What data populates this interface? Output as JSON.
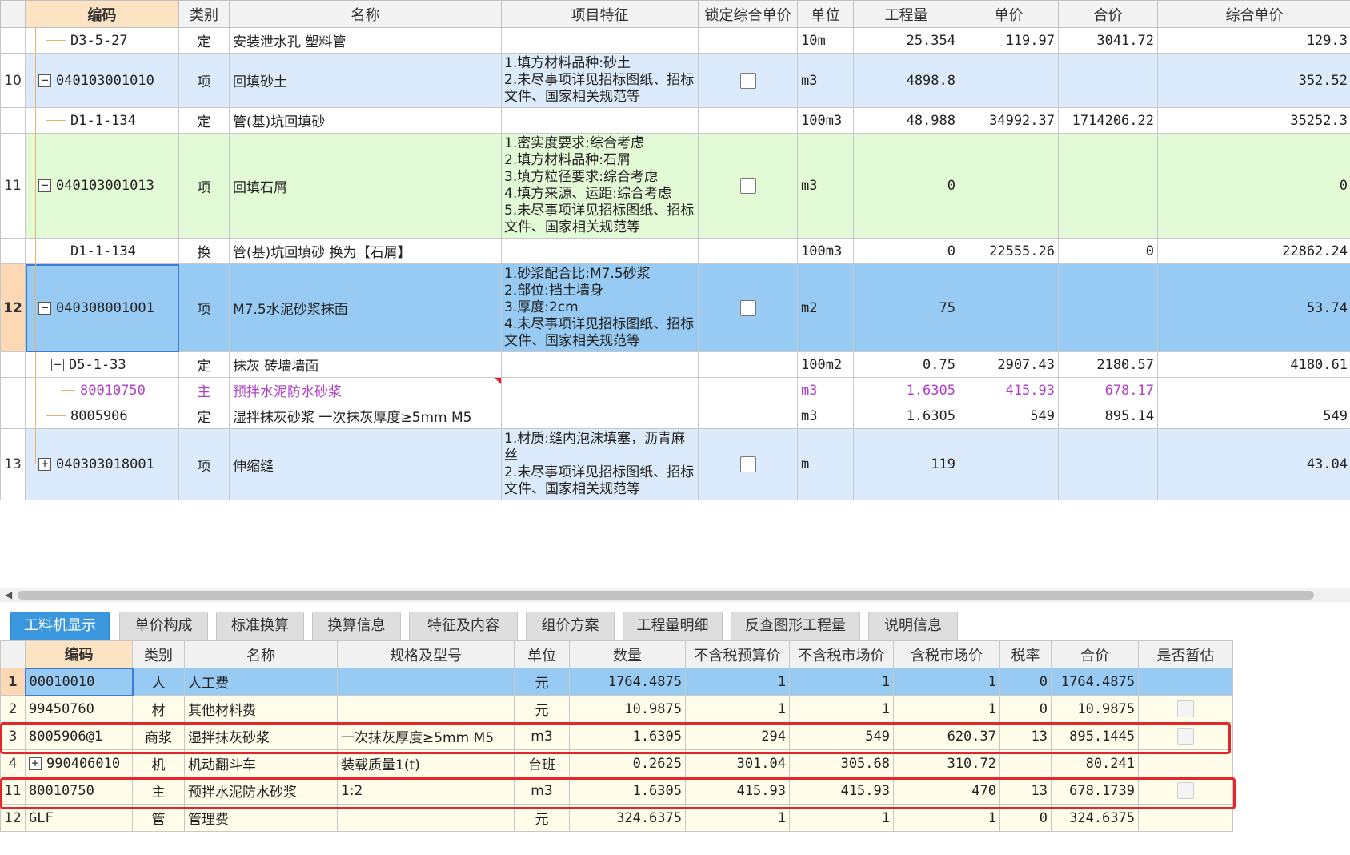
{
  "top_grid": {
    "headers": [
      "编码",
      "类别",
      "名称",
      "项目特征",
      "锁定综合单价",
      "单位",
      "工程量",
      "单价",
      "合价",
      "综合单价"
    ],
    "rows": [
      {
        "num": "",
        "code": "D3-5-27",
        "cat": "定",
        "name": "安装泄水孔 塑料管",
        "feat": [],
        "lock": false,
        "unit": "10m",
        "qty": "25.354",
        "price": "119.97",
        "total": "3041.72",
        "comp": "129.3"
      },
      {
        "num": "10",
        "code": "040103001010",
        "cat": "项",
        "name": "回填砂土",
        "feat": [
          "1.填方材料品种:砂土",
          "2.未尽事项详见招标图纸、招标",
          "文件、国家相关规范等"
        ],
        "lock": true,
        "unit": "m3",
        "qty": "4898.8",
        "price": "",
        "total": "",
        "comp": "352.52"
      },
      {
        "num": "",
        "code": "D1-1-134",
        "cat": "定",
        "name": "管(基)坑回填砂",
        "feat": [],
        "lock": false,
        "unit": "100m3",
        "qty": "48.988",
        "price": "34992.37",
        "total": "1714206.22",
        "comp": "35252.3"
      },
      {
        "num": "11",
        "code": "040103001013",
        "cat": "项",
        "name": "回填石屑",
        "feat": [
          "1.密实度要求:综合考虑",
          "2.填方材料品种:石屑",
          "3.填方粒径要求:综合考虑",
          "4.填方来源、运距:综合考虑",
          "5.未尽事项详见招标图纸、招标",
          "文件、国家相关规范等"
        ],
        "lock": true,
        "unit": "m3",
        "qty": "0",
        "price": "",
        "total": "",
        "comp": "0"
      },
      {
        "num": "",
        "code": "D1-1-134",
        "cat": "换",
        "name": "管(基)坑回填砂  换为【石屑】",
        "feat": [],
        "lock": false,
        "unit": "100m3",
        "qty": "0",
        "price": "22555.26",
        "total": "0",
        "comp": "22862.24"
      },
      {
        "num": "12",
        "code": "040308001001",
        "cat": "项",
        "name": "M7.5水泥砂浆抹面",
        "feat": [
          "1.砂浆配合比:M7.5砂浆",
          "2.部位:挡土墙身",
          "3.厚度:2cm",
          "4.未尽事项详见招标图纸、招标",
          "文件、国家相关规范等"
        ],
        "lock": true,
        "unit": "m2",
        "qty": "75",
        "price": "",
        "total": "",
        "comp": "53.74"
      },
      {
        "num": "",
        "code": "D5-1-33",
        "cat": "定",
        "name": "抹灰 砖墙墙面",
        "feat": [],
        "lock": false,
        "unit": "100m2",
        "qty": "0.75",
        "price": "2907.43",
        "total": "2180.57",
        "comp": "4180.61"
      },
      {
        "num": "",
        "code": "80010750",
        "cat": "主",
        "name": "预拌水泥防水砂浆",
        "feat": [],
        "lock": false,
        "unit": "m3",
        "qty": "1.6305",
        "price": "415.93",
        "total": "678.17",
        "comp": ""
      },
      {
        "num": "",
        "code": "8005906",
        "cat": "定",
        "name": "湿拌抹灰砂浆 一次抹灰厚度≥5mm M5",
        "feat": [],
        "lock": false,
        "unit": "m3",
        "qty": "1.6305",
        "price": "549",
        "total": "895.14",
        "comp": "549"
      },
      {
        "num": "13",
        "code": "040303018001",
        "cat": "项",
        "name": "伸缩缝",
        "feat": [
          "1.材质:缝内泡沫填塞，沥青麻",
          "丝",
          "2.未尽事项详见招标图纸、招标",
          "文件、国家相关规范等"
        ],
        "lock": true,
        "unit": "m",
        "qty": "119",
        "price": "",
        "total": "",
        "comp": "43.04"
      }
    ]
  },
  "tabs": [
    "工料机显示",
    "单价构成",
    "标准换算",
    "换算信息",
    "特征及内容",
    "组价方案",
    "工程量明细",
    "反查图形工程量",
    "说明信息"
  ],
  "bottom_grid": {
    "headers": [
      "编码",
      "类别",
      "名称",
      "规格及型号",
      "单位",
      "数量",
      "不含税预算价",
      "不含税市场价",
      "含税市场价",
      "税率",
      "合价",
      "是否暂估"
    ],
    "rows": [
      {
        "num": "1",
        "code": "00010010",
        "cat": "人",
        "name": "人工费",
        "spec": "",
        "unit": "元",
        "qty": "1764.4875",
        "budget": "1",
        "market": "1",
        "taxmarket": "1",
        "rate": "0",
        "total": "1764.4875",
        "est": false
      },
      {
        "num": "2",
        "code": "99450760",
        "cat": "材",
        "name": "其他材料费",
        "spec": "",
        "unit": "元",
        "qty": "10.9875",
        "budget": "1",
        "market": "1",
        "taxmarket": "1",
        "rate": "0",
        "total": "10.9875",
        "est": true
      },
      {
        "num": "3",
        "code": "8005906@1",
        "cat": "商浆",
        "name": "湿拌抹灰砂浆",
        "spec": "一次抹灰厚度≥5mm M5",
        "unit": "m3",
        "qty": "1.6305",
        "budget": "294",
        "market": "549",
        "taxmarket": "620.37",
        "rate": "13",
        "total": "895.1445",
        "est": true
      },
      {
        "num": "4",
        "code": "990406010",
        "cat": "机",
        "name": "机动翻斗车",
        "spec": "装载质量1(t)",
        "unit": "台班",
        "qty": "0.2625",
        "budget": "301.04",
        "market": "305.68",
        "taxmarket": "310.72",
        "rate": "",
        "total": "80.241",
        "est": false
      },
      {
        "num": "11",
        "code": "80010750",
        "cat": "主",
        "name": "预拌水泥防水砂浆",
        "spec": "1:2",
        "unit": "m3",
        "qty": "1.6305",
        "budget": "415.93",
        "market": "415.93",
        "taxmarket": "470",
        "rate": "13",
        "total": "678.1739",
        "est": true
      },
      {
        "num": "12",
        "code": "GLF",
        "cat": "管",
        "name": "管理费",
        "spec": "",
        "unit": "元",
        "qty": "324.6375",
        "budget": "1",
        "market": "1",
        "taxmarket": "1",
        "rate": "0",
        "total": "324.6375",
        "est": false
      }
    ]
  },
  "colors": {
    "selected_row": "#97cbf3",
    "item_row_blue": "#dcebfb",
    "item_row_green": "#e3fad7",
    "highlight_box": "#e4262a",
    "active_tab": "#3a97dd",
    "main_material_text": "#b040c8"
  }
}
